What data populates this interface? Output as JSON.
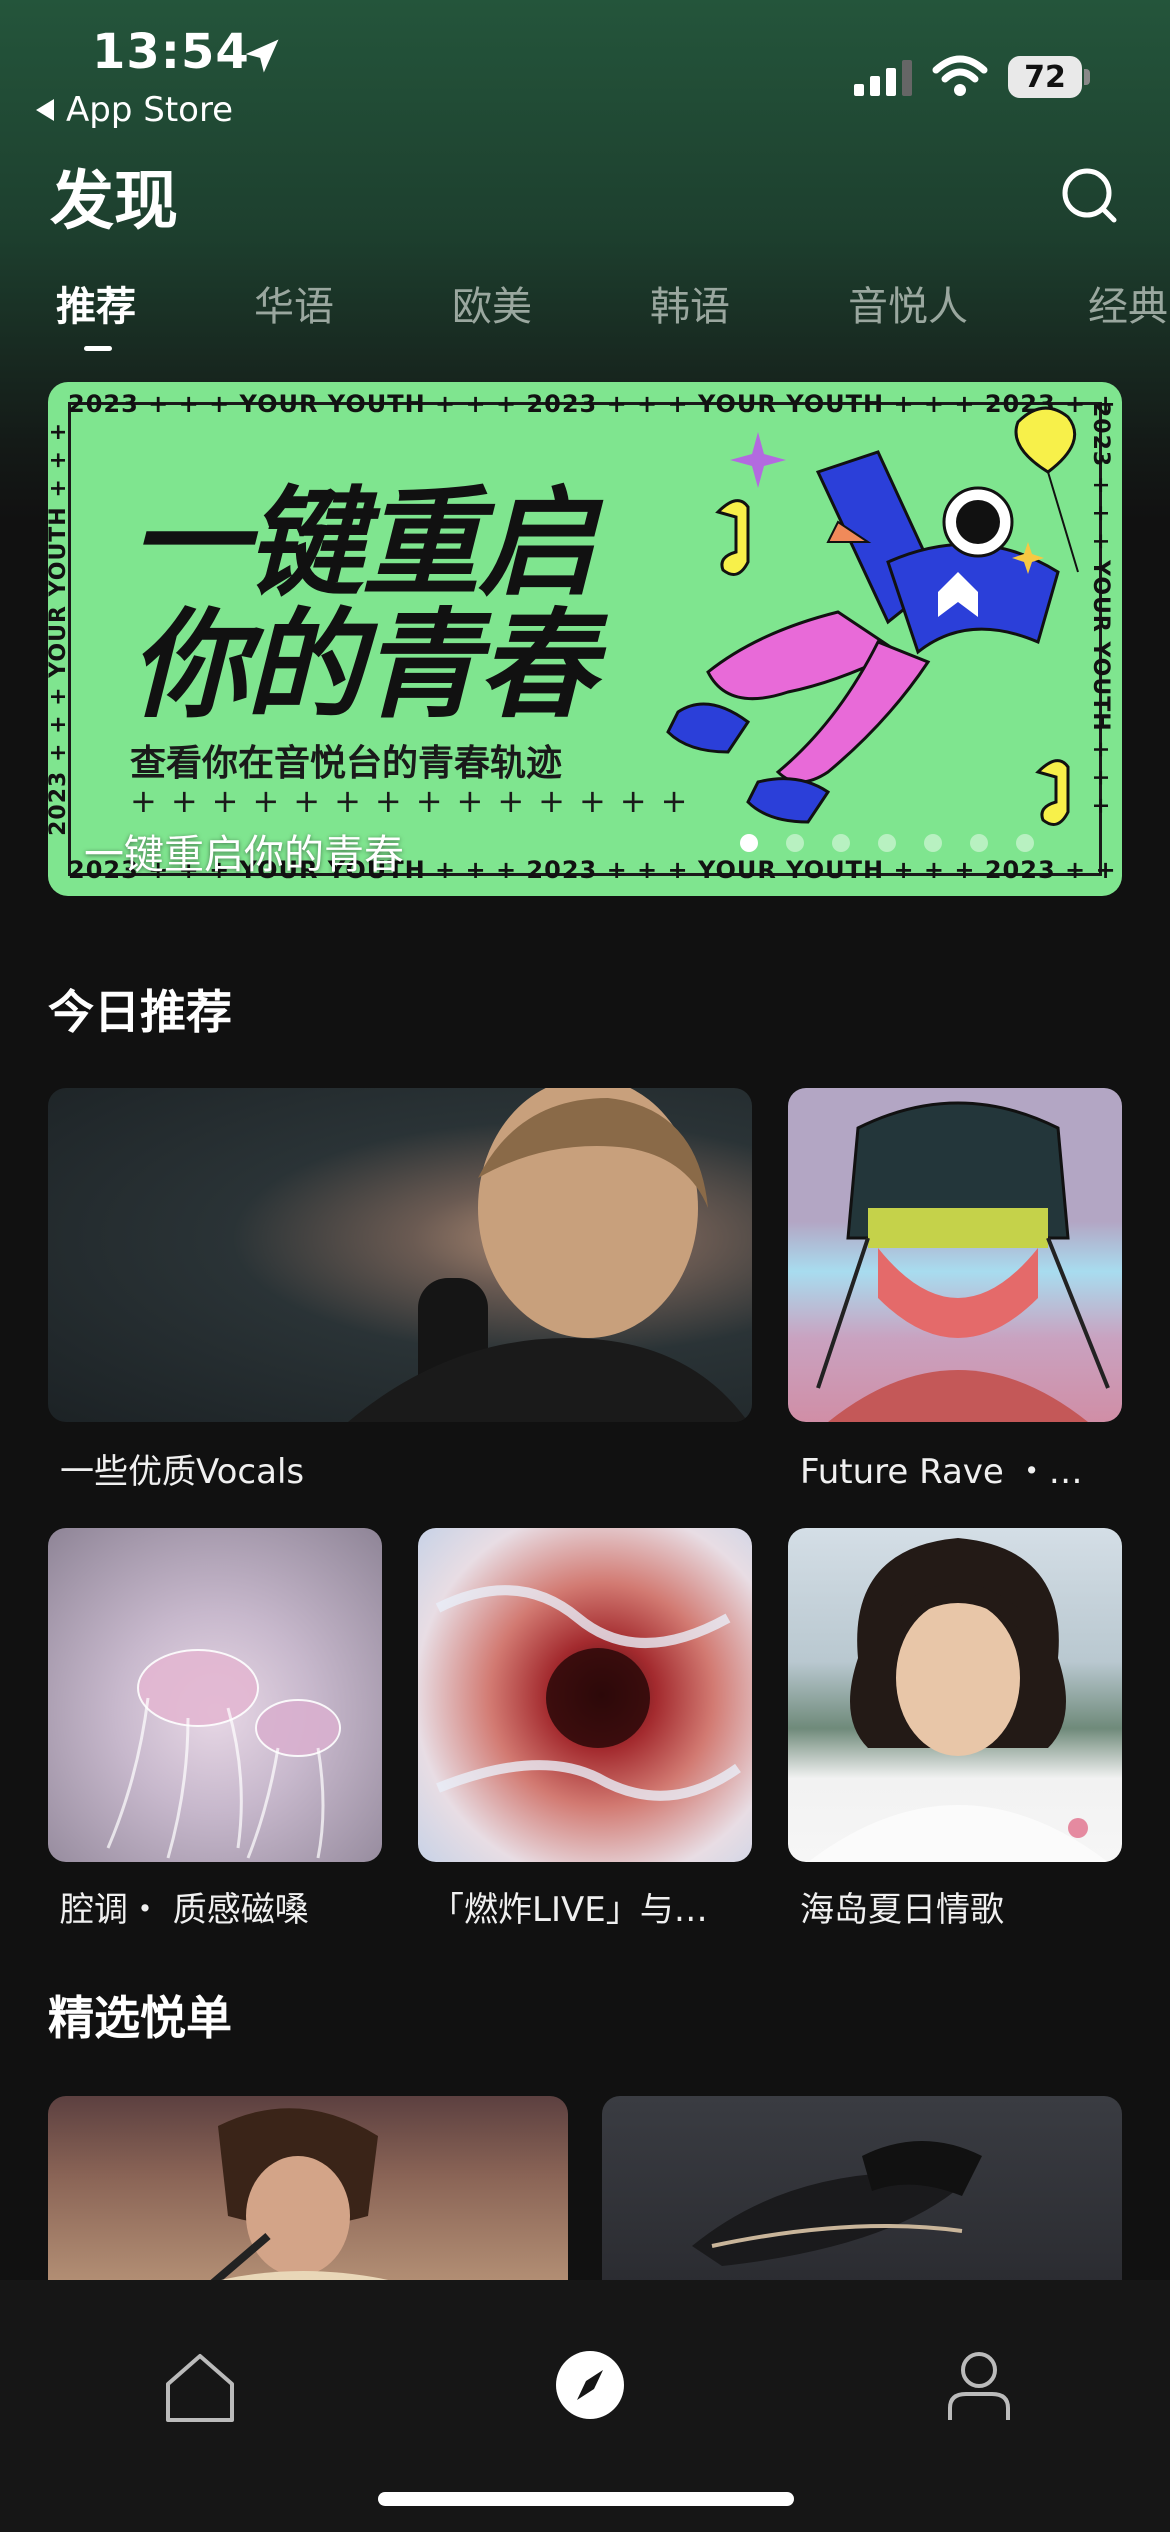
{
  "status_bar": {
    "time": "13:54",
    "back_app": "App Store",
    "battery": "72"
  },
  "header": {
    "title": "发现",
    "search_icon": "search-icon"
  },
  "tabs": [
    {
      "label": "推荐",
      "active": true
    },
    {
      "label": "华语",
      "active": false
    },
    {
      "label": "欧美",
      "active": false
    },
    {
      "label": "韩语",
      "active": false
    },
    {
      "label": "音悦人",
      "active": false
    },
    {
      "label": "经典",
      "active": false
    }
  ],
  "banner": {
    "strip_text": "2023 + + + YOUR YOUTH + + +",
    "headline_line1": "一键重启",
    "headline_line2": "你的青春",
    "subtitle": "查看你在音悦台的青春轨迹",
    "caption": "一键重启你的青春",
    "slide_count": 7,
    "active_slide": 0
  },
  "today_section": {
    "title": "今日推荐",
    "items": [
      {
        "label": "一些优质Vocals"
      },
      {
        "label": "Future Rave ・…"
      },
      {
        "label": "腔调・ 质感磁嗓"
      },
      {
        "label": "「燃炸LIVE」与…"
      },
      {
        "label": "海岛夏日情歌"
      }
    ]
  },
  "featured_section": {
    "title": "精选悦单"
  },
  "bottom_nav": [
    {
      "name": "home",
      "icon": "home-icon"
    },
    {
      "name": "discover",
      "icon": "compass-icon",
      "active": true
    },
    {
      "name": "profile",
      "icon": "person-icon"
    }
  ],
  "colors": {
    "background": "#111111",
    "header_green": "#24553b",
    "banner_green": "#7fe58f",
    "tab_inactive": "#9aa79f"
  }
}
